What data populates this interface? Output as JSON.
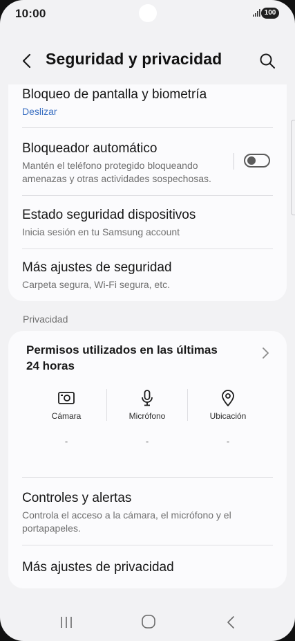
{
  "status_bar": {
    "time": "10:00",
    "battery": "100"
  },
  "header": {
    "title": "Seguridad y privacidad"
  },
  "security": {
    "items": [
      {
        "title": "Bloqueo de pantalla y biometría",
        "subtitle": "Deslizar"
      },
      {
        "title": "Bloqueador automático",
        "subtitle": "Mantén el teléfono protegido bloqueando amenazas y otras actividades sospechosas.",
        "toggle_on": false
      },
      {
        "title": "Estado seguridad dispositivos",
        "subtitle": "Inicia sesión en tu Samsung account"
      },
      {
        "title": "Más ajustes de seguridad",
        "subtitle": "Carpeta segura, Wi-Fi segura, etc."
      }
    ]
  },
  "privacy": {
    "section_label": "Privacidad",
    "permissions_title": "Permisos utilizados en las últimas 24 horas",
    "permissions": [
      {
        "icon": "camera-icon",
        "label": "Cámara",
        "value": "-"
      },
      {
        "icon": "microphone-icon",
        "label": "Micrófono",
        "value": "-"
      },
      {
        "icon": "location-icon",
        "label": "Ubicación",
        "value": "-"
      }
    ],
    "items": [
      {
        "title": "Controles y alertas",
        "subtitle": "Controla el acceso a la cámara, el micrófono y el portapapeles."
      },
      {
        "title": "Más ajustes de privacidad"
      }
    ]
  },
  "navbar": {
    "icons": [
      "recent-apps-icon",
      "home-icon",
      "back-icon"
    ]
  }
}
